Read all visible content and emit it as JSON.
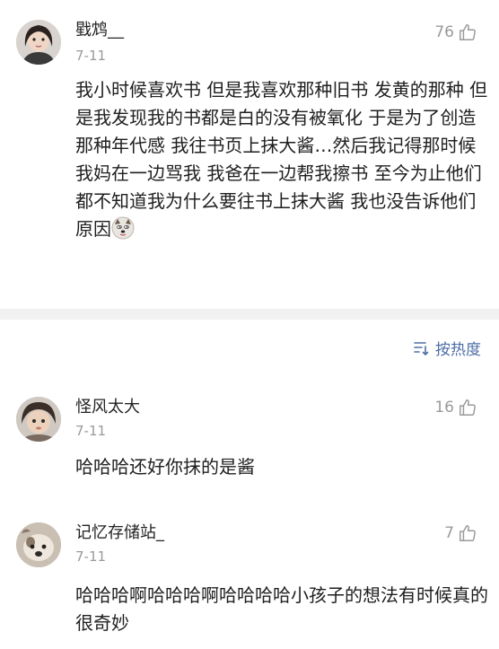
{
  "comments": [
    {
      "username": "戥鸩__",
      "date": "7-11",
      "likes": "76",
      "text": "我小时候喜欢书 但是我喜欢那种旧书 发黄的那种 但是我发现我的书都是白的没有被氧化 于是为了创造那种年代感 我往书页上抹大酱…然后我记得那时候我妈在一边骂我 我爸在一边帮我擦书 至今为止他们都不知道我为什么要往书上抹大酱 我也没告诉他们原因",
      "emoji": "doge-emoji"
    },
    {
      "username": "怪风太大",
      "date": "7-11",
      "likes": "16",
      "text": "哈哈哈还好你抹的是酱"
    },
    {
      "username": "记忆存储站_",
      "date": "7-11",
      "likes": "7",
      "text": "哈哈哈啊哈哈哈啊哈哈哈哈小孩子的想法有时候真的很奇妙"
    }
  ],
  "sort": {
    "label": "按热度",
    "icon": "sort-icon"
  },
  "icons": {
    "like": "thumbs-up-icon"
  },
  "colors": {
    "accent": "#4e6ea6",
    "meta": "#9a9a9a",
    "divider": "#f1f1f1"
  }
}
